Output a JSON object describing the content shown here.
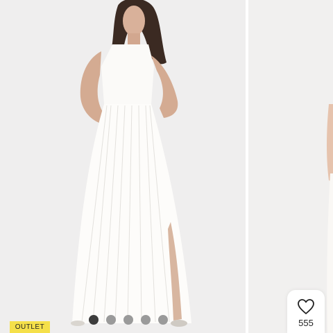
{
  "badge": {
    "label": "OUTLET"
  },
  "carousel": {
    "slide_count": 5,
    "active_index": 0
  },
  "wishlist": {
    "count": "555"
  },
  "icons": {
    "wishlist": "heart-outline-icon"
  },
  "colors": {
    "badge_bg": "#f5e04a",
    "dot_active": "#3c3c3c",
    "dot_inactive": "#9a9a9a"
  }
}
